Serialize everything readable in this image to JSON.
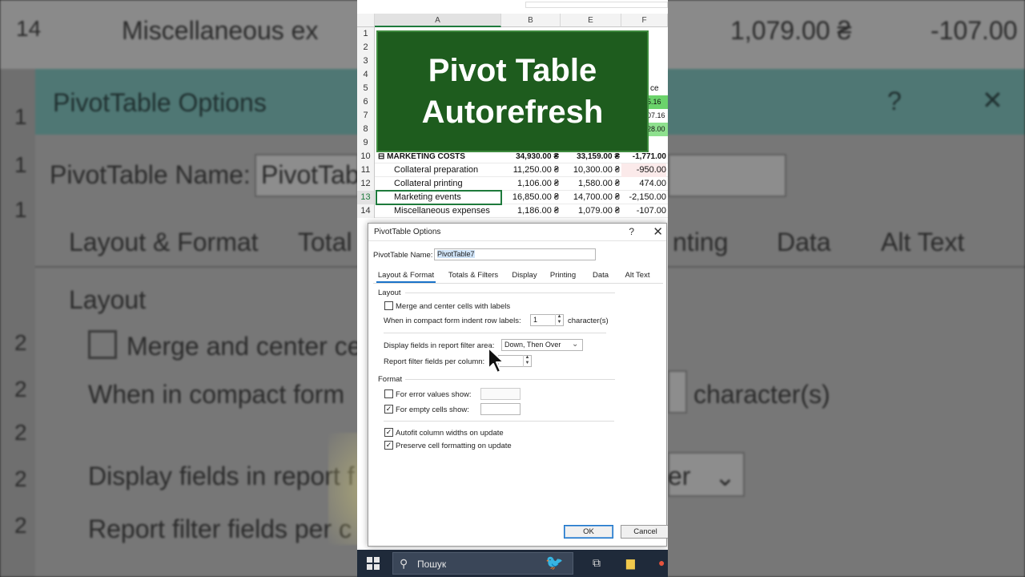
{
  "banner": {
    "line1": "Pivot Table",
    "line2": "Autorefresh"
  },
  "sheet": {
    "columns": [
      "A",
      "B",
      "E",
      "F"
    ],
    "row_numbers": [
      "1",
      "2",
      "3",
      "4",
      "5",
      "6",
      "7",
      "8",
      "9",
      "10",
      "11",
      "12",
      "13",
      "14"
    ],
    "partial_f": {
      "r5": "ce",
      "r6": "5.16",
      "r7": "07.16",
      "r8": "28.00"
    },
    "rows": [
      {
        "num": "10",
        "label": "MARKETING COSTS",
        "b": "34,930.00 ₴",
        "e": "33,159.00 ₴",
        "f": "-1,771.00",
        "bold": true
      },
      {
        "num": "11",
        "label": "Collateral preparation",
        "b": "11,250.00 ₴",
        "e": "10,300.00 ₴",
        "f": "-950.00"
      },
      {
        "num": "12",
        "label": "Collateral printing",
        "b": "1,106.00 ₴",
        "e": "1,580.00 ₴",
        "f": "474.00"
      },
      {
        "num": "13",
        "label": "Marketing events",
        "b": "16,850.00 ₴",
        "e": "14,700.00 ₴",
        "f": "-2,150.00"
      },
      {
        "num": "14",
        "label": "Miscellaneous expenses",
        "b": "1,186.00 ₴",
        "e": "1,079.00 ₴",
        "f": "-107.00"
      }
    ]
  },
  "dialog": {
    "title": "PivotTable Options",
    "help": "?",
    "close": "✕",
    "name_label": "PivotTable Name:",
    "name_value": "PivotTable7",
    "tabs": [
      "Layout & Format",
      "Totals & Filters",
      "Display",
      "Printing",
      "Data",
      "Alt Text"
    ],
    "layout_section": "Layout",
    "merge_label": "Merge and center cells with labels",
    "indent_label": "When in compact form indent row labels:",
    "indent_value": "1",
    "indent_unit": "character(s)",
    "display_fields_label": "Display fields in report filter area:",
    "display_fields_value": "Down, Then Over",
    "report_filter_label": "Report filter fields per column:",
    "format_section": "Format",
    "error_label": "For error values show:",
    "empty_label": "For empty cells show:",
    "autofit_label": "Autofit column widths on update",
    "preserve_label": "Preserve cell formatting on update",
    "ok": "OK",
    "cancel": "Cancel",
    "checks": {
      "merge": false,
      "error": false,
      "empty": true,
      "autofit": true,
      "preserve": true
    }
  },
  "background": {
    "title": "PivotTable Options",
    "name_label": "PivotTable Name:",
    "name_partial": "PivotTab",
    "row14": "14",
    "misc": "Miscellaneous ex",
    "misc_e": "1,079.00 ₴",
    "misc_f": "-107.00",
    "tab1": "Layout & Format",
    "tab2": "Total",
    "tab_r1": "nting",
    "tab_r2": "Data",
    "tab_r3": "Alt Text",
    "layout": "Layout",
    "merge": "Merge and center ce",
    "indent": "When in compact form",
    "chars": "character(s)",
    "display": "Display fields in report f",
    "report": "Report filter fields per c",
    "dropdown_partial": "er"
  },
  "taskbar": {
    "search_placeholder": "Пошук"
  },
  "colors": {
    "banner": "#1e5c1e",
    "dialog_accent": "#1a73c8",
    "taskbar": "#1f2a3a"
  }
}
